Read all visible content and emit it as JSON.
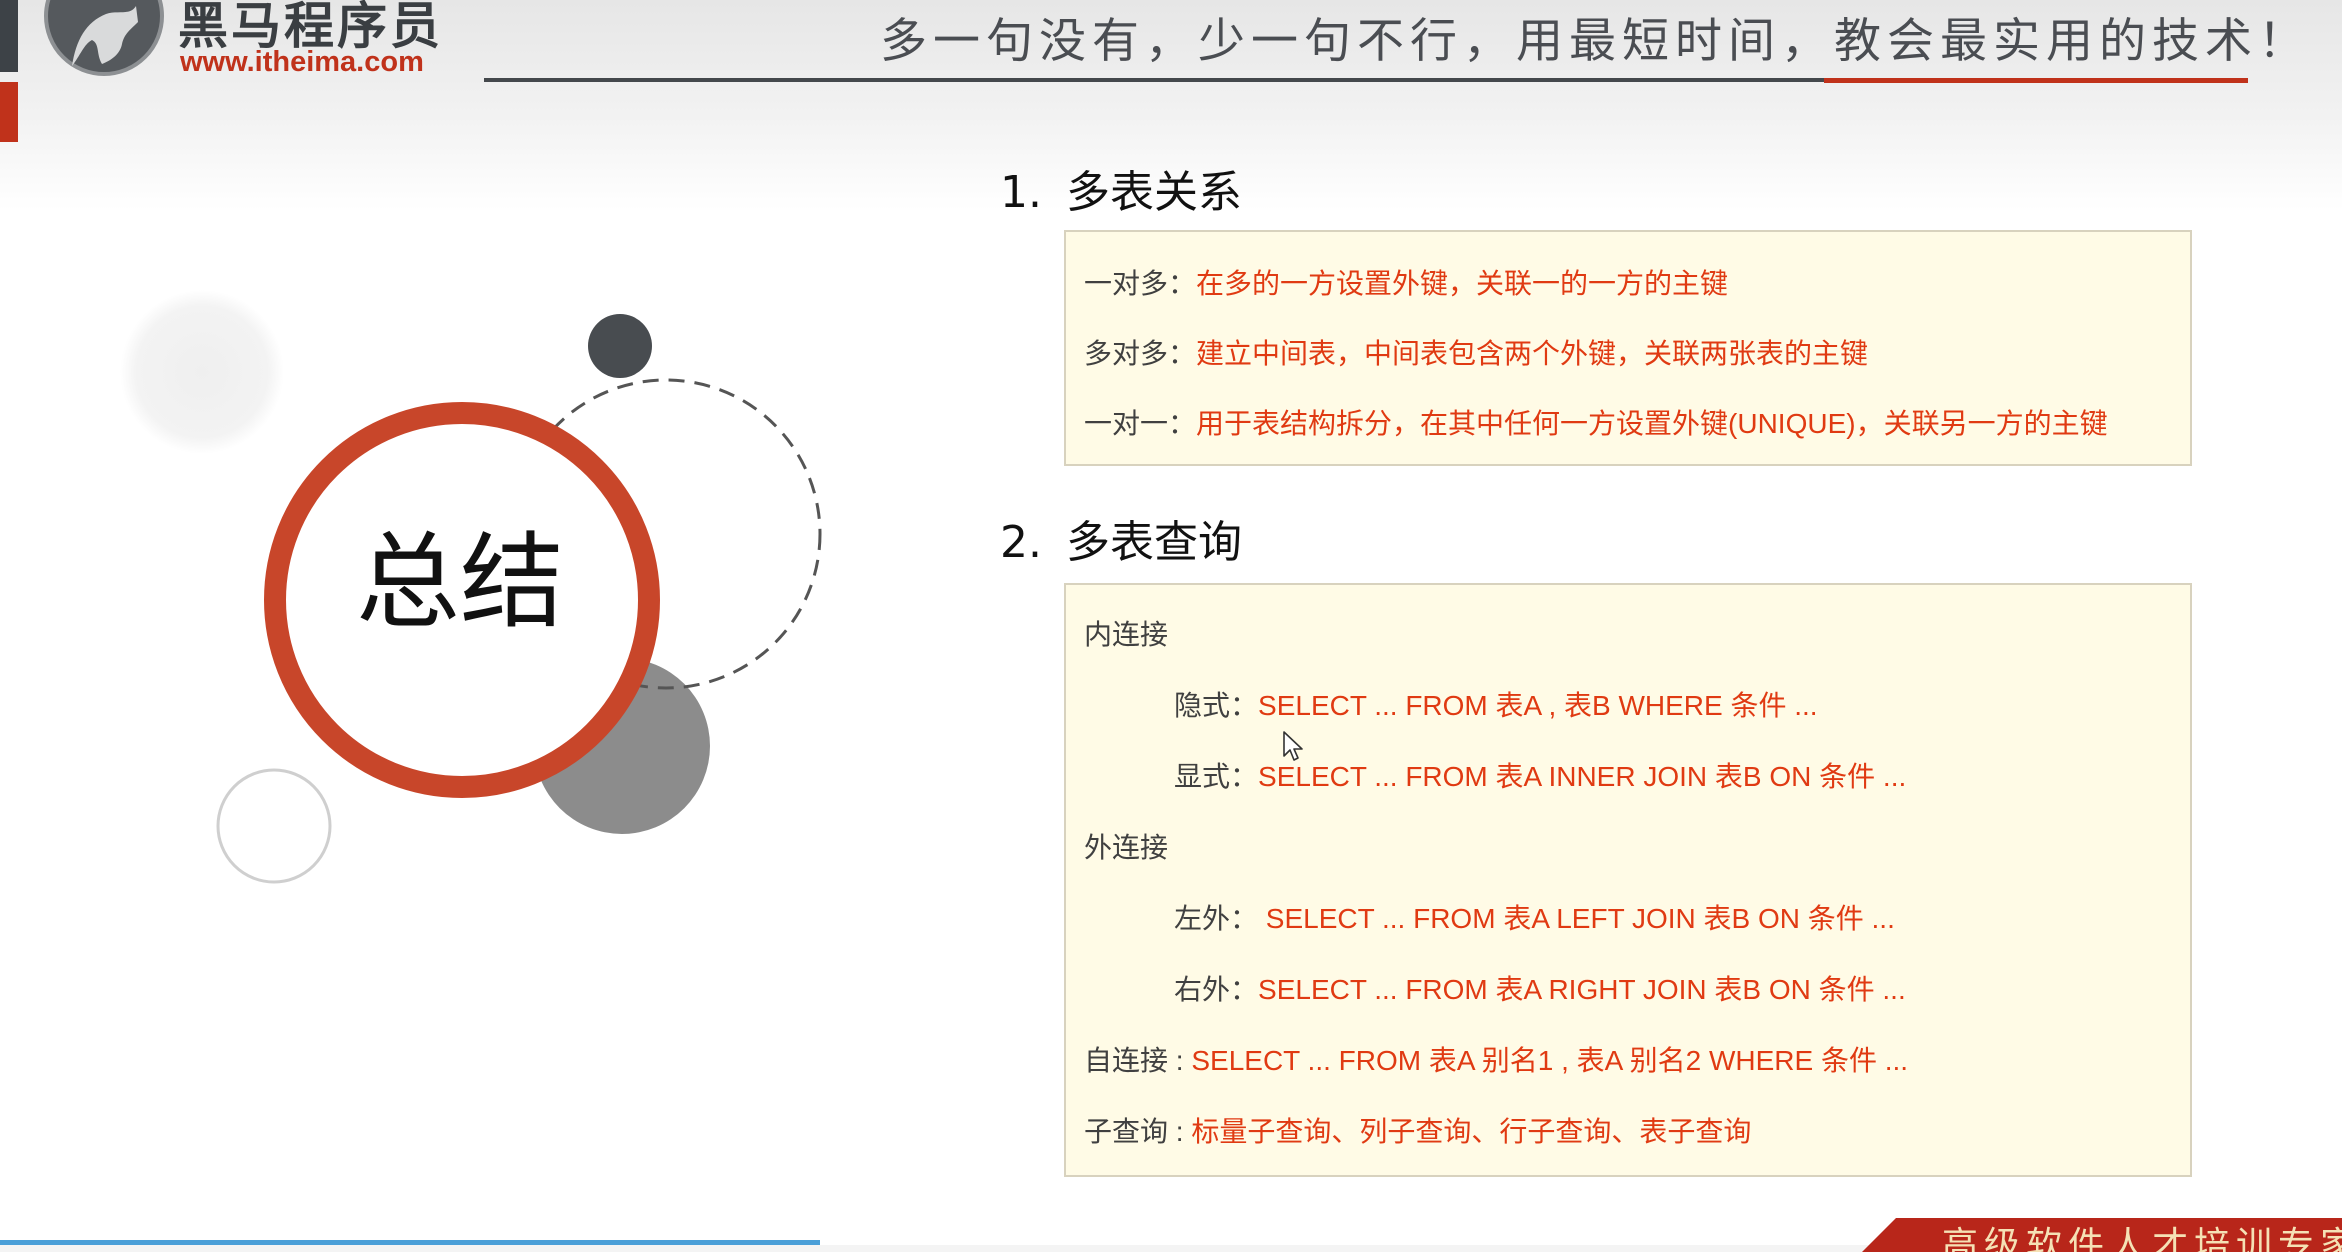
{
  "header": {
    "logo_name": "黑马程序员",
    "logo_url": "www.itheima.com",
    "slogan": "多一句没有，少一句不行，用最短时间，教会最实用的技术！"
  },
  "summary": {
    "title": "总结"
  },
  "section1": {
    "number": "1.",
    "title": "多表关系",
    "items": [
      {
        "label": "一对多：",
        "value": "在多的一方设置外键，关联一的一方的主键"
      },
      {
        "label": "多对多：",
        "value": "建立中间表，中间表包含两个外键，关联两张表的主键"
      },
      {
        "label": "一对一：",
        "value": "用于表结构拆分，在其中任何一方设置外键(UNIQUE)，关联另一方的主键"
      }
    ]
  },
  "section2": {
    "number": "2.",
    "title": "多表查询",
    "inner_join": {
      "heading": "内连接",
      "implicit": {
        "label": "隐式：",
        "value": "SELECT ... FROM 表A , 表B  WHERE  条件 ..."
      },
      "explicit": {
        "label": "显式：",
        "value": "SELECT ... FROM 表A  INNER  JOIN  表B ON 条件 ..."
      }
    },
    "outer_join": {
      "heading": "外连接",
      "left": {
        "label": "左外：",
        "value": " SELECT ... FROM 表A  LEFT  JOIN  表B ON 条件 ..."
      },
      "right": {
        "label": "右外：",
        "value": "SELECT ... FROM 表A  RIGHT  JOIN  表B ON 条件 ..."
      }
    },
    "self_join": {
      "label": "自连接 : ",
      "value": "SELECT ... FROM 表A  别名1 , 表A  别名2  WHERE  条件 ..."
    },
    "subquery": {
      "label": "子查询 : ",
      "value": "标量子查询、列子查询、行子查询、表子查询"
    }
  },
  "footer": {
    "badge": "高级软件人才培训专家"
  },
  "colors": {
    "accent_red": "#e03a12",
    "brand_red": "#c0321b",
    "box_bg": "#fffbe6"
  },
  "icons": [
    "horse-logo-icon",
    "mouse-cursor-icon"
  ]
}
